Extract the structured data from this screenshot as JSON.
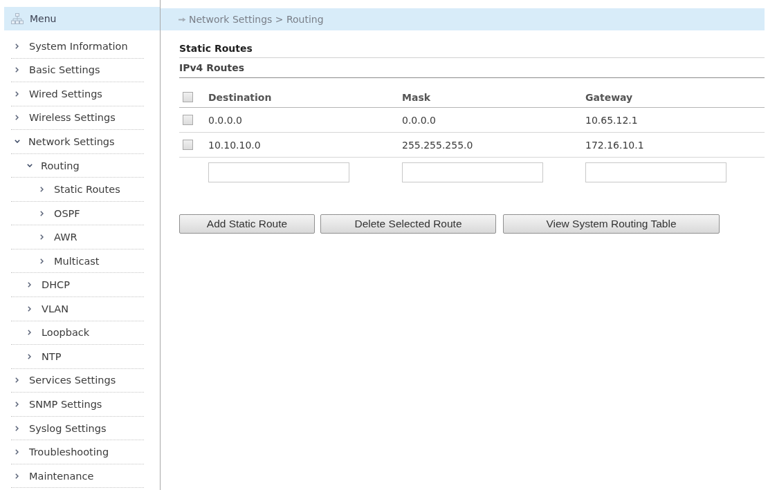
{
  "menu": {
    "title": "Menu",
    "items": [
      {
        "label": "System Information",
        "expanded": false
      },
      {
        "label": "Basic Settings",
        "expanded": false
      },
      {
        "label": "Wired Settings",
        "expanded": false
      },
      {
        "label": "Wireless Settings",
        "expanded": false
      },
      {
        "label": "Network Settings",
        "expanded": true,
        "children": [
          {
            "label": "Routing",
            "expanded": true,
            "children": [
              {
                "label": "Static Routes",
                "expanded": false
              },
              {
                "label": "OSPF",
                "expanded": false
              },
              {
                "label": "AWR",
                "expanded": false
              },
              {
                "label": "Multicast",
                "expanded": false
              }
            ]
          },
          {
            "label": "DHCP",
            "expanded": false
          },
          {
            "label": "VLAN",
            "expanded": false
          },
          {
            "label": "Loopback",
            "expanded": false
          },
          {
            "label": "NTP",
            "expanded": false
          }
        ]
      },
      {
        "label": "Services Settings",
        "expanded": false
      },
      {
        "label": "SNMP Settings",
        "expanded": false
      },
      {
        "label": "Syslog Settings",
        "expanded": false
      },
      {
        "label": "Troubleshooting",
        "expanded": false
      },
      {
        "label": "Maintenance",
        "expanded": false
      }
    ]
  },
  "breadcrumb": "Network Settings > Routing",
  "section_title": "Static Routes",
  "subsection_title": "IPv4 Routes",
  "table": {
    "select_all_checked": false,
    "columns": [
      "Destination",
      "Mask",
      "Gateway"
    ],
    "rows": [
      {
        "checked": false,
        "cells": [
          "0.0.0.0",
          "0.0.0.0",
          "10.65.12.1"
        ]
      },
      {
        "checked": false,
        "cells": [
          "10.10.10.0",
          "255.255.255.0",
          "172.16.10.1"
        ]
      }
    ]
  },
  "buttons": [
    "Add Static Route",
    "Delete Selected Route",
    "View System Routing Table"
  ]
}
